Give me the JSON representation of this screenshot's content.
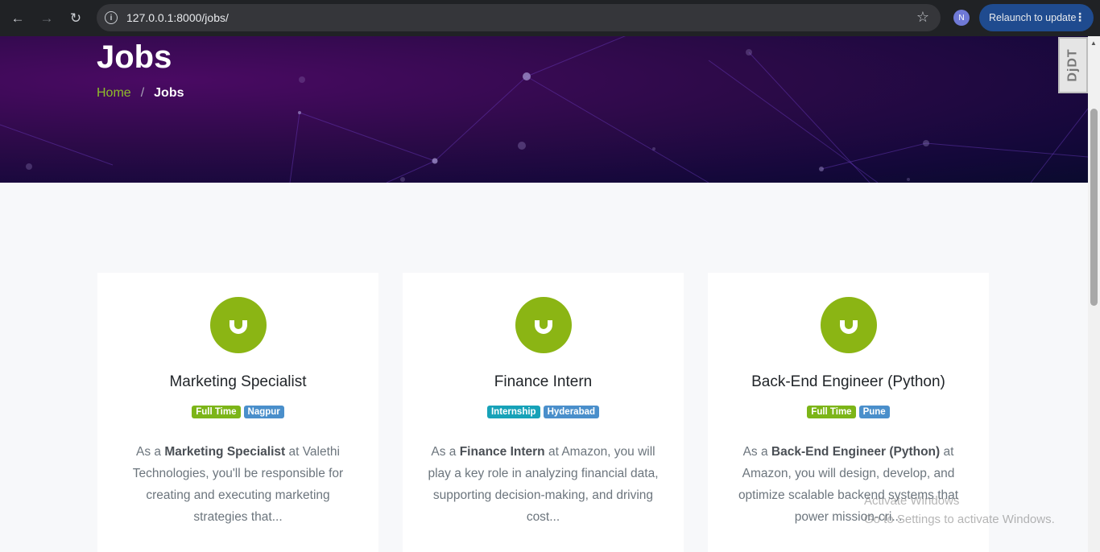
{
  "browser": {
    "url": "127.0.0.1:8000/jobs/",
    "profile_initial": "N",
    "relaunch_label": "Relaunch to update"
  },
  "hero": {
    "title": "Jobs",
    "breadcrumb": {
      "home": "Home",
      "separator": "/",
      "current": "Jobs"
    }
  },
  "debug_toolbar": {
    "label": "DjDT"
  },
  "colors": {
    "accent": "#8bb514",
    "badge_green": "#7cb518",
    "badge_blue": "#4a8fcb",
    "badge_teal": "#17a2b8"
  },
  "jobs": [
    {
      "title": "Marketing Specialist",
      "badges": [
        {
          "label": "Full Time",
          "color": "#7cb518"
        },
        {
          "label": "Nagpur",
          "color": "#4a8fcb"
        }
      ],
      "desc_prefix": "As a ",
      "desc_highlight": "Marketing Specialist",
      "desc_suffix": " at Valethi Technologies, you'll be responsible for creating and executing marketing strategies that..."
    },
    {
      "title": "Finance Intern",
      "badges": [
        {
          "label": "Internship",
          "color": "#17a2b8"
        },
        {
          "label": "Hyderabad",
          "color": "#4a8fcb"
        }
      ],
      "desc_prefix": "As a ",
      "desc_highlight": "Finance Intern",
      "desc_suffix": " at Amazon, you will play a key role in analyzing financial data, supporting decision-making, and driving cost..."
    },
    {
      "title": "Back-End Engineer (Python)",
      "badges": [
        {
          "label": "Full Time",
          "color": "#7cb518"
        },
        {
          "label": "Pune",
          "color": "#4a8fcb"
        }
      ],
      "desc_prefix": "As a ",
      "desc_highlight": "Back-End Engineer (Python)",
      "desc_suffix": " at Amazon, you will design, develop, and optimize scalable backend systems that power mission-cri..."
    }
  ],
  "watermark": {
    "line1": "Activate Windows",
    "line2": "Go to Settings to activate Windows."
  }
}
